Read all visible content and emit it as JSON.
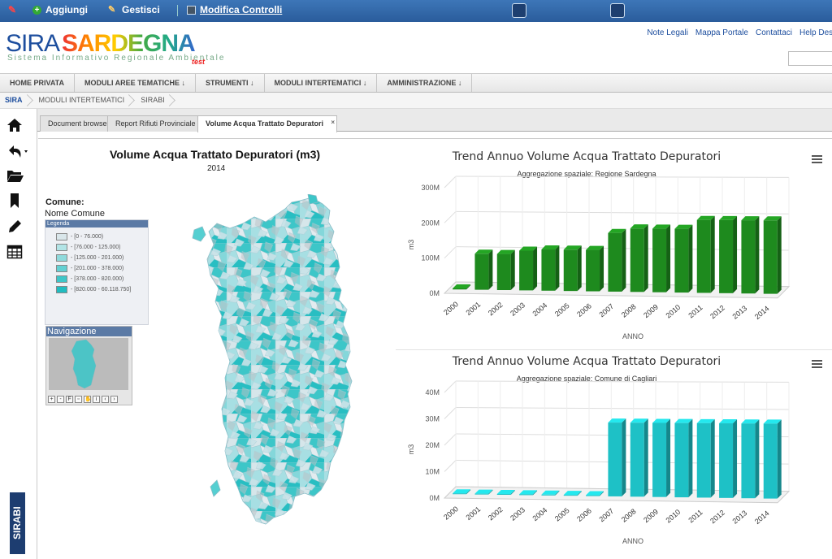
{
  "topbar": {
    "aggiungi": "Aggiungi",
    "gestisci": "Gestisci",
    "modifica": "Modifica Controlli"
  },
  "header": {
    "brand_a": "SIRA",
    "brand_b": "SARDEGNA",
    "subtitle": "Sistema Informativo Regionale Ambientale",
    "env": "test",
    "links": [
      "Note Legali",
      "Mappa Portale",
      "Contattaci",
      "Help Desk"
    ]
  },
  "menu": [
    "HOME PRIVATA",
    "MODULI AREE TEMATICHE ↓",
    "STRUMENTI ↓",
    "MODULI INTERTEMATICI ↓",
    "AMMINISTRAZIONE ↓"
  ],
  "breadcrumb": [
    "SIRA",
    "MODULI INTERTEMATICI",
    "SIRABI"
  ],
  "side_tab": "SIRABI",
  "tabs": [
    "Document browser",
    "Report Rifiuti Provinciale",
    "Volume Acqua Trattato Depuratori"
  ],
  "map": {
    "title": "Volume Acqua Trattato Depuratori (m3)",
    "year": "2014",
    "comune_label": "Comune:",
    "comune_value": "Nome Comune",
    "legend_title": "Legenda",
    "navigation_title": "Navigazione",
    "legend": [
      {
        "label": "- [0 - 76.000)",
        "color": "#d9e6ea"
      },
      {
        "label": "- [76.000 - 125.000)",
        "color": "#b2e4e6"
      },
      {
        "label": "- [125.000 - 201.000)",
        "color": "#8fdadc"
      },
      {
        "label": "- [201.000 - 378.000)",
        "color": "#63d0d2"
      },
      {
        "label": "- [378.000 - 820.000)",
        "color": "#3ec6c8"
      },
      {
        "label": "- [820.000 - 60.118.750]",
        "color": "#21bcc0"
      }
    ]
  },
  "chart_data": [
    {
      "type": "bar",
      "title": "Trend Annuo Volume Acqua Trattato Depuratori",
      "subtitle": "Aggregazione spaziale: Regione Sardegna",
      "xlabel": "ANNO",
      "ylabel": "m3",
      "ylim": [
        0,
        300
      ],
      "yticks": [
        "0M",
        "100M",
        "200M",
        "300M"
      ],
      "color": "#1e8a1e",
      "categories": [
        "2000",
        "2001",
        "2002",
        "2003",
        "2004",
        "2005",
        "2006",
        "2007",
        "2008",
        "2009",
        "2010",
        "2011",
        "2012",
        "2013",
        "2014"
      ],
      "values": [
        3,
        102,
        102,
        112,
        116,
        116,
        116,
        164,
        177,
        177,
        177,
        202,
        202,
        202,
        202
      ]
    },
    {
      "type": "bar",
      "title": "Trend Annuo Volume Acqua Trattato Depuratori",
      "subtitle": "Aggregazione spaziale: Comune di Cagliari",
      "xlabel": "ANNO",
      "ylabel": "m3",
      "ylim": [
        0,
        40
      ],
      "yticks": [
        "0M",
        "10M",
        "20M",
        "30M",
        "40M"
      ],
      "color": "#1ec1c6",
      "categories": [
        "2000",
        "2001",
        "2002",
        "2003",
        "2004",
        "2005",
        "2006",
        "2007",
        "2008",
        "2009",
        "2010",
        "2011",
        "2012",
        "2013",
        "2014"
      ],
      "values": [
        0.3,
        0.3,
        0.3,
        0.3,
        0.3,
        0.3,
        0.3,
        27.5,
        27.5,
        27.5,
        27.5,
        27.5,
        27.5,
        27.5,
        27.5
      ]
    }
  ]
}
